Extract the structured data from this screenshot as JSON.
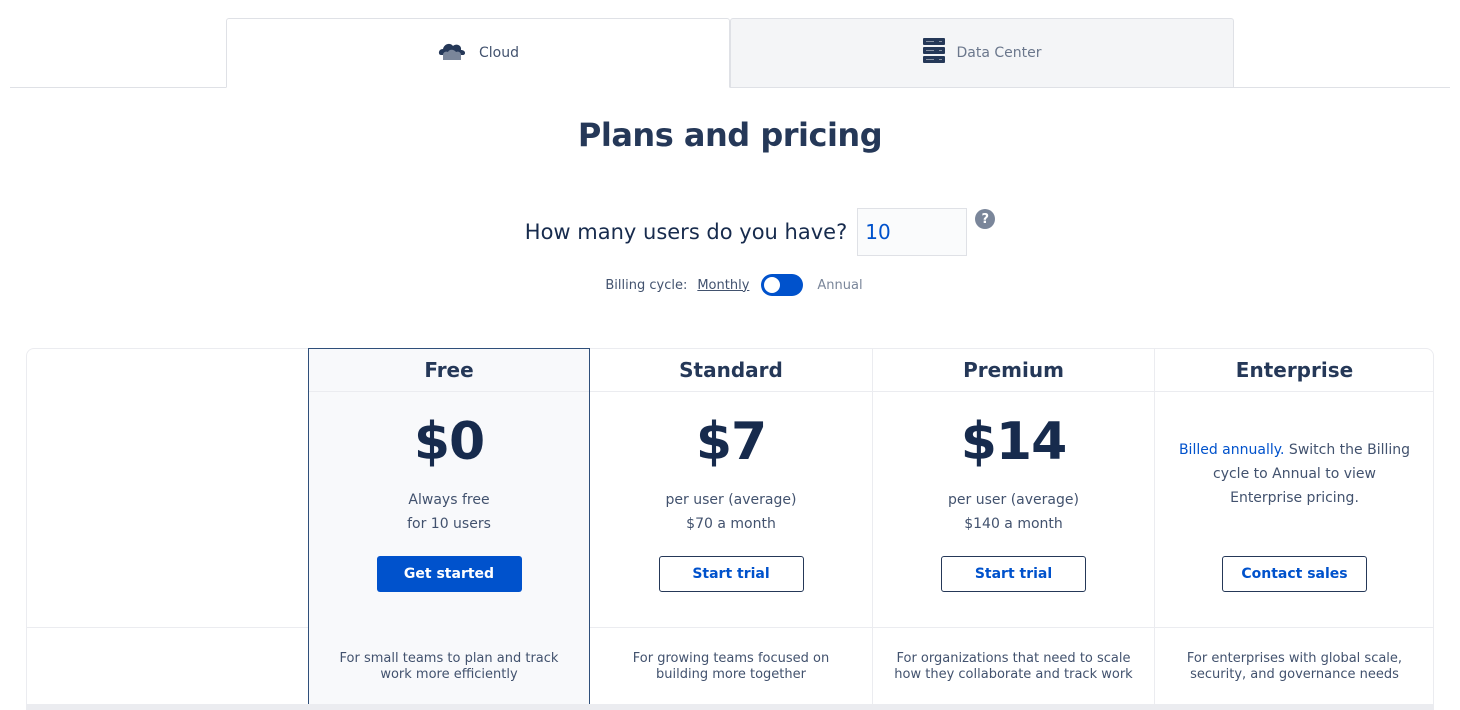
{
  "tabs": [
    {
      "label": "Cloud",
      "icon": "cloud-icon",
      "active": true
    },
    {
      "label": "Data Center",
      "icon": "server-icon",
      "active": false
    }
  ],
  "title": "Plans and pricing",
  "users": {
    "question": "How many users do you have?",
    "value": "10",
    "help_glyph": "?"
  },
  "billing": {
    "label": "Billing cycle:",
    "monthly": "Monthly",
    "annual": "Annual",
    "selected": "Monthly"
  },
  "colors": {
    "primary": "#0052cc",
    "heading": "#253858",
    "text": "#42526e"
  },
  "plans": [
    {
      "name": "Free",
      "price": "$0",
      "line1": "Always free",
      "line2": "for 10 users",
      "button": "Get started",
      "description": "For small teams to plan and track work more efficiently"
    },
    {
      "name": "Standard",
      "price": "$7",
      "line1": "per user (average)",
      "line2": "$70 a month",
      "button": "Start trial",
      "description": "For growing teams focused on building more together"
    },
    {
      "name": "Premium",
      "price": "$14",
      "line1": "per user (average)",
      "line2": "$140 a month",
      "button": "Start trial",
      "description": "For organizations that need to scale how they collaborate and track work"
    },
    {
      "name": "Enterprise",
      "note_link": "Billed annually.",
      "note_text": " Switch the Billing cycle to Annual to view Enterprise pricing.",
      "button": "Contact sales",
      "description": "For enterprises with global scale, security, and governance needs"
    }
  ]
}
